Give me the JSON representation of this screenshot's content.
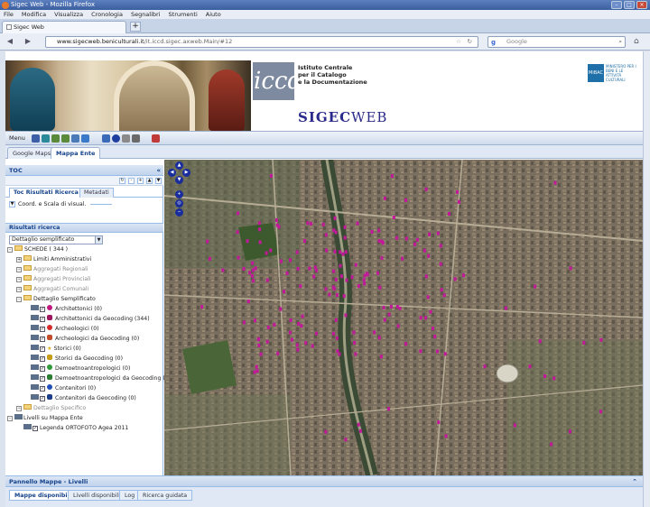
{
  "browser": {
    "window_title": "Sigec Web - Mozilla Firefox",
    "menu": [
      "File",
      "Modifica",
      "Visualizza",
      "Cronologia",
      "Segnalibri",
      "Strumenti",
      "Aiuto"
    ],
    "tab_title": "Sigec Web",
    "new_tab": "+",
    "url_domain": "www.sigecweb.beniculturali.it",
    "url_rest": "/it.iccd.sigec.axweb.Main/#12",
    "search_placeholder": "Google",
    "search_engine_letter": "g"
  },
  "header": {
    "logo_text": "iccd",
    "institute_line1": "Istituto Centrale",
    "institute_line2": "per il Catalogo",
    "institute_line3": "e la Documentazione",
    "app_name_bold": "SIGEC",
    "app_name_rest": "WEB",
    "ministry_mark": "MiBAC",
    "ministry_text": "MINISTERO PER I BENI E LE ATTIVITÀ CULTURALI"
  },
  "toolbar": {
    "menu_label": "Menu"
  },
  "map_tabs": [
    {
      "label": "Google Maps",
      "active": false
    },
    {
      "label": "Mappa Ente",
      "active": true
    }
  ],
  "toc": {
    "title": "TOC",
    "tabs": [
      {
        "label": "Toc Risultati Ricerca",
        "active": true
      },
      {
        "label": "Metadati",
        "active": false
      }
    ],
    "coord_label": "Coord. e Scala di visual.",
    "results_title": "Risultati ricerca",
    "detail_select": "Dettaglio semplificato",
    "tree": {
      "schede": "SCHEDE ( 344 )",
      "limiti": "Limiti Amministrativi",
      "agg_regionali": "Aggregati Regionali",
      "agg_provinciali": "Aggregati Provinciali",
      "agg_comunali": "Aggregati Comunali",
      "dettaglio_semplificato": "Dettaglio Semplificato",
      "items": [
        {
          "label": "Architettonici (0)",
          "color": "#c0197c",
          "shape": "dot"
        },
        {
          "label": "Architettonici da Geocoding (344)",
          "color": "#a0165e",
          "shape": "pin"
        },
        {
          "label": "Archeologici (0)",
          "color": "#d62a2a",
          "shape": "dot"
        },
        {
          "label": "Archeologici da Geocoding (0)",
          "color": "#c24c2a",
          "shape": "pin"
        },
        {
          "label": "Storici (0)",
          "color": "#e0b020",
          "shape": "star"
        },
        {
          "label": "Storici da Geocoding (0)",
          "color": "#c79a18",
          "shape": "pin"
        },
        {
          "label": "Demoetnoantropologici (0)",
          "color": "#2e9a3a",
          "shape": "dot"
        },
        {
          "label": "Demoetnoantropologici da Geocoding (0)",
          "color": "#2a7d30",
          "shape": "pin"
        },
        {
          "label": "Contenitori (0)",
          "color": "#1f4fb8",
          "shape": "dot"
        },
        {
          "label": "Contenitori da Geocoding (0)",
          "color": "#1a3d8a",
          "shape": "pin"
        }
      ],
      "dettaglio_specifico": "Dettaglio Specifico",
      "livelli": "Livelli su Mappa Ente",
      "legenda": "Legenda ORTOFOTO Agea 2011"
    }
  },
  "bottom_panel": {
    "title": "Pannello Mappe - Livelli",
    "tabs": [
      {
        "label": "Mappe disponibili",
        "active": true
      },
      {
        "label": "Livelli disponibili",
        "active": false
      },
      {
        "label": "Log",
        "active": false
      },
      {
        "label": "Ricerca guidata",
        "active": false
      }
    ]
  },
  "colors": {
    "marker": "#c2189a",
    "panel_header_text": "#15428b",
    "app_name": "#2a2a8a"
  }
}
